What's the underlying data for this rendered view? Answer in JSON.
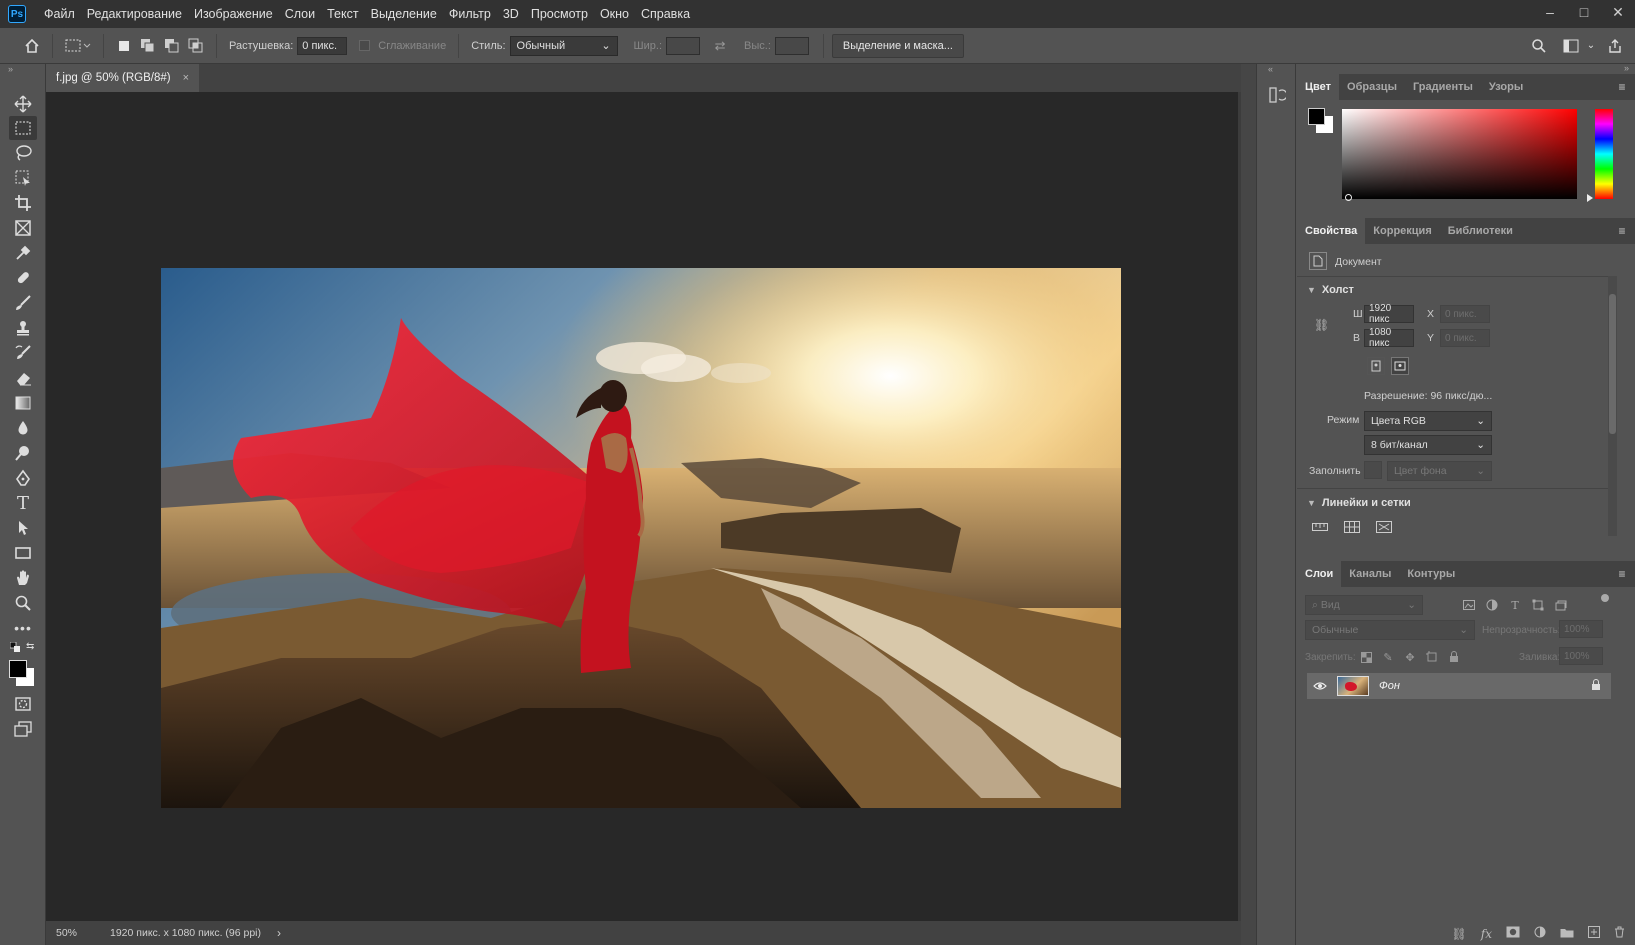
{
  "app": {
    "logo": "Ps"
  },
  "menu": [
    "Файл",
    "Редактирование",
    "Изображение",
    "Слои",
    "Текст",
    "Выделение",
    "Фильтр",
    "3D",
    "Просмотр",
    "Окно",
    "Справка"
  ],
  "window_controls": {
    "minimize": "–",
    "maximize": "□",
    "close": "✕"
  },
  "options": {
    "feather_label": "Растушевка:",
    "feather_value": "0 пикс.",
    "antialias_label": "Сглаживание",
    "style_label": "Стиль:",
    "style_value": "Обычный",
    "width_label": "Шир.:",
    "height_label": "Выс.:",
    "select_mask_button": "Выделение и маска..."
  },
  "document": {
    "tab_title": "f.jpg @ 50% (RGB/8#)",
    "tab_close": "×",
    "zoom": "50%",
    "status_info": "1920 пикс. x 1080 пикс. (96 ppi)",
    "status_arrow": "›"
  },
  "color_panel": {
    "tabs": [
      "Цвет",
      "Образцы",
      "Градиенты",
      "Узоры"
    ],
    "foreground": "#000000",
    "background": "#ffffff",
    "hue": "#ff0000"
  },
  "properties_panel": {
    "tabs": [
      "Свойства",
      "Коррекция",
      "Библиотеки"
    ],
    "doc_label": "Документ",
    "canvas_section": "Холст",
    "w_label": "Ш",
    "w_value": "1920 пикс",
    "h_label": "В",
    "h_value": "1080 пикс",
    "x_label": "X",
    "x_value": "0 пикс.",
    "y_label": "Y",
    "y_value": "0 пикс.",
    "resolution": "Разрешение: 96 пикс/дю...",
    "mode_label": "Режим",
    "mode_value": "Цвета RGB",
    "depth_value": "8 бит/канал",
    "fill_label": "Заполнить",
    "fill_value": "Цвет фона",
    "rulers_section": "Линейки и сетки"
  },
  "layers_panel": {
    "tabs": [
      "Слои",
      "Каналы",
      "Контуры"
    ],
    "search_placeholder": "Вид",
    "blend_mode": "Обычные",
    "opacity_label": "Непрозрачность:",
    "opacity_value": "100%",
    "lock_label": "Закрепить:",
    "fill_label": "Заливка:",
    "fill_value": "100%",
    "layers": [
      {
        "name": "Фон",
        "visible": true,
        "locked": true
      }
    ]
  }
}
